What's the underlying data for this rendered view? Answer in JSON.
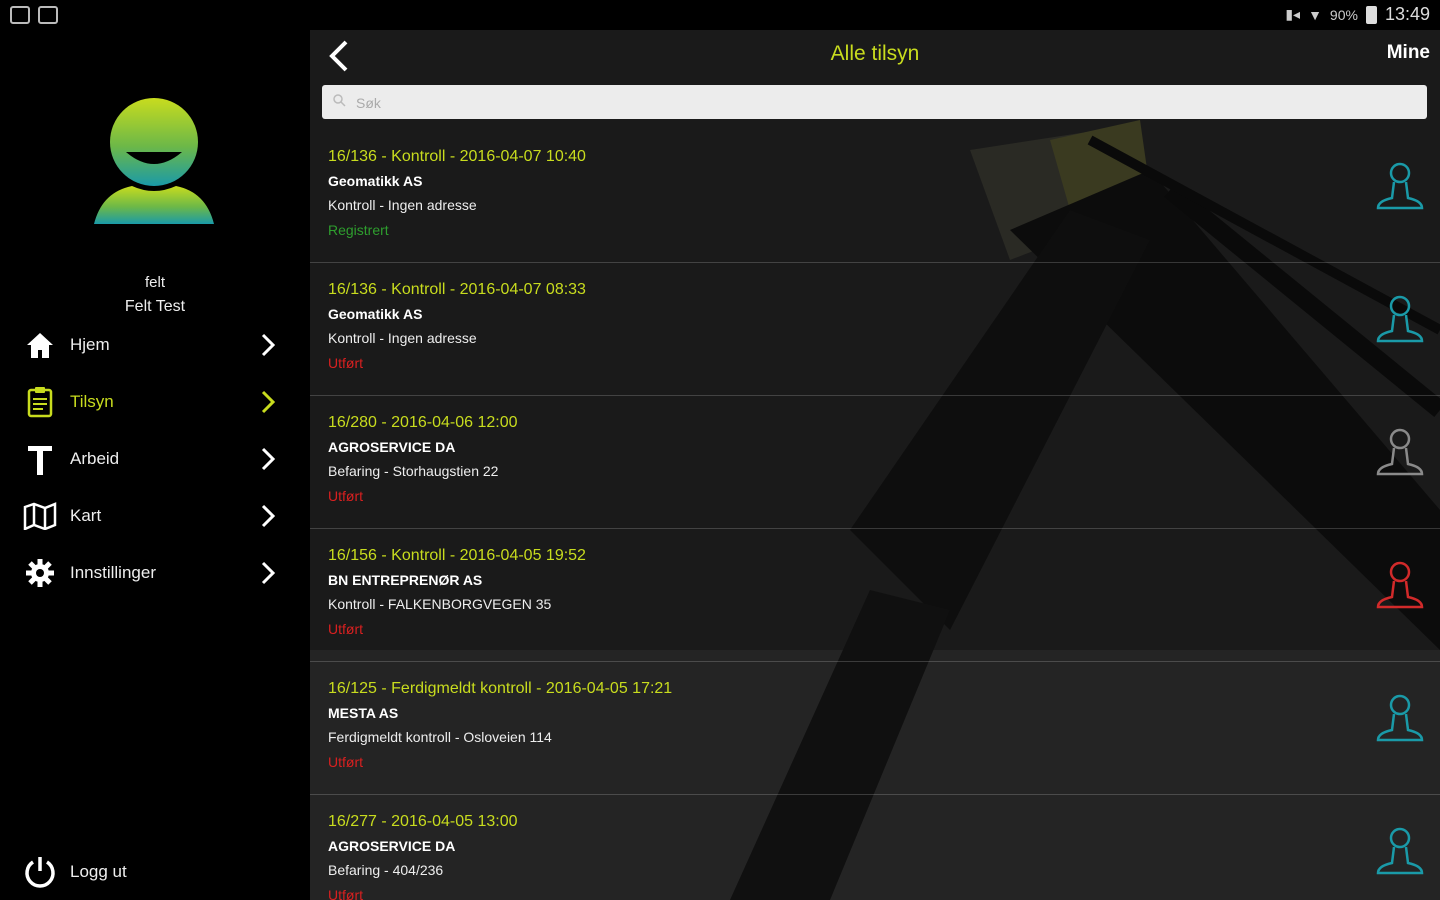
{
  "statusbar": {
    "time": "13:49",
    "battery": "90%"
  },
  "sidebar": {
    "user_short": "felt",
    "user_full": "Felt Test",
    "items": [
      {
        "label": "Hjem",
        "icon": "home-icon",
        "active": false
      },
      {
        "label": "Tilsyn",
        "icon": "clipboard-icon",
        "active": true
      },
      {
        "label": "Arbeid",
        "icon": "hammer-icon",
        "active": false
      },
      {
        "label": "Kart",
        "icon": "map-icon",
        "active": false
      },
      {
        "label": "Innstillinger",
        "icon": "gear-icon",
        "active": false
      }
    ],
    "logout_label": "Logg ut"
  },
  "header": {
    "title": "Alle tilsyn",
    "right_label": "Mine"
  },
  "search": {
    "placeholder": "Søk"
  },
  "colors": {
    "accent": "#c8dc1e",
    "registered": "#2e9e2e",
    "done": "#d82020",
    "person_teal": "#1a9aa8",
    "person_gray": "#8a8a8a",
    "person_red": "#d22a2a"
  },
  "inspections": [
    {
      "title": "16/136 - Kontroll - 2016-04-07 10:40",
      "company": "Geomatikk AS",
      "desc": "Kontroll - Ingen adresse",
      "status": "Registrert",
      "status_color": "#2e9e2e",
      "person_color": "#1a9aa8"
    },
    {
      "title": "16/136 - Kontroll - 2016-04-07 08:33",
      "company": "Geomatikk AS",
      "desc": "Kontroll - Ingen adresse",
      "status": "Utført",
      "status_color": "#d82020",
      "person_color": "#1a9aa8"
    },
    {
      "title": "16/280 - 2016-04-06 12:00",
      "company": "AGROSERVICE DA",
      "desc": "Befaring - Storhaugstien 22",
      "status": "Utført",
      "status_color": "#d82020",
      "person_color": "#8a8a8a"
    },
    {
      "title": "16/156 - Kontroll - 2016-04-05 19:52",
      "company": "BN ENTREPRENØR AS",
      "desc": "Kontroll - FALKENBORGVEGEN 35",
      "status": "Utført",
      "status_color": "#d82020",
      "person_color": "#d22a2a"
    },
    {
      "title": "16/125 - Ferdigmeldt kontroll - 2016-04-05 17:21",
      "company": "MESTA AS",
      "desc": "Ferdigmeldt kontroll - Osloveien 114",
      "status": "Utført",
      "status_color": "#d82020",
      "person_color": "#1a9aa8"
    },
    {
      "title": "16/277 - 2016-04-05 13:00",
      "company": "AGROSERVICE DA",
      "desc": "Befaring - 404/236",
      "status": "Utført",
      "status_color": "#d82020",
      "person_color": "#1a9aa8"
    }
  ]
}
